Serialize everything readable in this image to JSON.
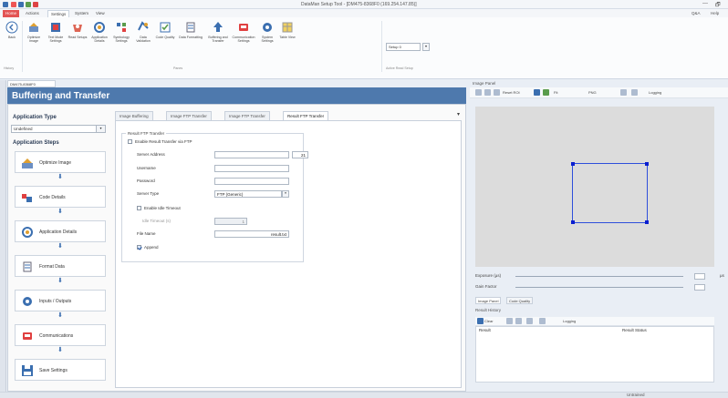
{
  "window": {
    "title": "DataMan Setup Tool - [DM475-8368F0 (169.254.147.85)]",
    "controls": [
      "—",
      "🗗"
    ]
  },
  "ribbon_tabs": [
    {
      "label": "Home",
      "state": "home"
    },
    {
      "label": "Actions",
      "state": "normal"
    },
    {
      "label": "Settings",
      "state": "active"
    },
    {
      "label": "System",
      "state": "normal"
    },
    {
      "label": "View",
      "state": "normal"
    }
  ],
  "help": {
    "qa_label": "Q&A",
    "help_label": "Help"
  },
  "ribbon": {
    "buttons": [
      {
        "label": "Back",
        "icon": "back-icon"
      },
      {
        "label": "Optimize Image",
        "icon": "optimize-image-icon"
      },
      {
        "label": "Text Mode Settings",
        "icon": "text-mode-icon"
      },
      {
        "label": "Read Setups",
        "icon": "read-setups-icon"
      },
      {
        "label": "Application Details",
        "icon": "application-details-icon"
      },
      {
        "label": "Symbology Settings",
        "icon": "symbology-icon"
      },
      {
        "label": "Data Validation",
        "icon": "data-validation-icon"
      },
      {
        "label": "Code Quality",
        "icon": "code-quality-icon"
      },
      {
        "label": "Data Formatting",
        "icon": "data-formatting-icon"
      },
      {
        "label": "Buffering and Transfer",
        "icon": "buffering-transfer-icon"
      },
      {
        "label": "Communication Settings",
        "icon": "communication-icon"
      },
      {
        "label": "System Settings",
        "icon": "system-settings-icon"
      },
      {
        "label": "Table View",
        "icon": "table-view-icon"
      }
    ],
    "groups": {
      "history": "History",
      "panes": "Panes",
      "active_read_setup": "Active Read Setup"
    },
    "setup_select": "Setup 0"
  },
  "doc_tab": "DM475-8368F0",
  "main": {
    "title": "Buffering and Transfer",
    "application_type": {
      "heading": "Application Type",
      "value": "Undefined"
    },
    "steps_heading": "Application Steps",
    "steps": [
      {
        "label": "Optimize Image",
        "icon": "optimize-image-icon"
      },
      {
        "label": "Code Details",
        "icon": "code-details-icon"
      },
      {
        "label": "Application Details",
        "icon": "application-details-icon"
      },
      {
        "label": "Format Data",
        "icon": "format-data-icon"
      },
      {
        "label": "Inputs / Outputs",
        "icon": "inputs-outputs-icon"
      },
      {
        "label": "Communications",
        "icon": "communications-icon"
      },
      {
        "label": "Save Settings",
        "icon": "save-icon"
      }
    ],
    "tabs": [
      {
        "label": "Image Buffering",
        "active": false
      },
      {
        "label": "Image FTP Transfer",
        "active": false
      },
      {
        "label": "Image FTP Transfer",
        "active": false
      },
      {
        "label": "Result FTP Transfer",
        "active": true
      }
    ],
    "form": {
      "group_title": "Result FTP Transfer",
      "enable_label": "Enable Result Transfer via FTP",
      "enable_checked": false,
      "server_address_label": "Server Address",
      "server_address_value": "",
      "port_value": "21",
      "username_label": "Username",
      "username_value": "",
      "password_label": "Password",
      "password_value": "",
      "server_type_label": "Server Type",
      "server_type_value": "FTP (Generic)",
      "enable_idle_label": "Enable Idle Timeout",
      "enable_idle_checked": false,
      "idle_timeout_label": "Idle Timeout (s)",
      "idle_timeout_value": "1",
      "file_name_label": "File Name",
      "file_name_value": "result.txt",
      "append_label": "Append",
      "append_checked": true
    }
  },
  "image_panel": {
    "header": "Image Panel",
    "toolbar": {
      "reset_roi": "Reset ROI",
      "fit": "Fit",
      "png": "PNG",
      "logging": "Logging"
    },
    "exposure_label": "Exposure (µs)",
    "exposure_unit": "µs",
    "gain_label": "Gain Factor",
    "sub_tabs": [
      {
        "label": "Image Panel",
        "active": true
      },
      {
        "label": "Code Quality",
        "active": false
      }
    ]
  },
  "results": {
    "header": "Result History",
    "clear_label": "Clear",
    "logging_label": "Logging",
    "columns": [
      "Result",
      "Result Status"
    ]
  },
  "status": {
    "text": "Untrained"
  }
}
